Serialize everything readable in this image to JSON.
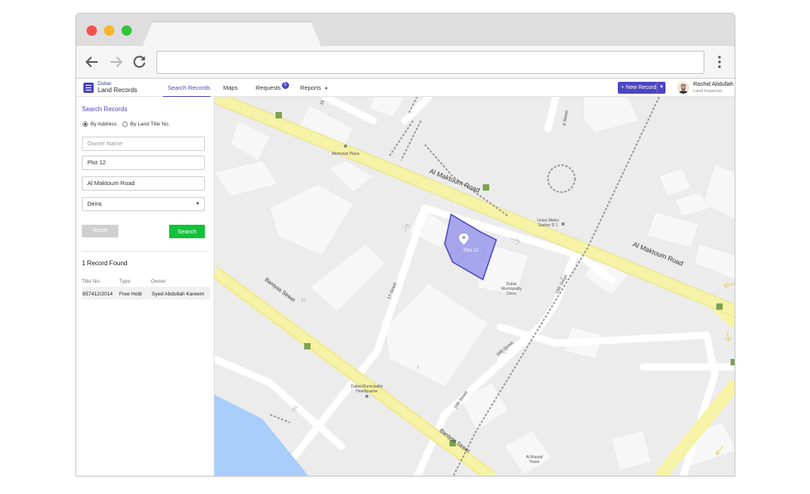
{
  "colors": {
    "accent": "#4c46bf",
    "search_button": "#12c23a",
    "major_road": "#f6f2a6",
    "water": "#a8cdfb",
    "plot_fill": "#9e9cea"
  },
  "app": {
    "brand_line1": "Dubai",
    "brand_line2": "Land Records"
  },
  "nav": {
    "search_records": "Search Records",
    "maps": "Maps",
    "requests": "Requests",
    "requests_count": "5",
    "reports": "Reports"
  },
  "header": {
    "new_record": "New Record",
    "user_name": "Rashid Abdullah",
    "user_role": "Land Inspector"
  },
  "search": {
    "title": "Search Records",
    "option_address": "By Address",
    "option_title_no": "By Land Title No.",
    "owner_placeholder": "Owner Name",
    "plot_value": "Plot 12",
    "street_value": "Al Maktoum Road",
    "area_selected": "Deira",
    "reset_label": "Reset",
    "search_label": "Search"
  },
  "results": {
    "count_label": "1 Record Found",
    "columns": [
      "Title No.",
      "Type",
      "Owner"
    ],
    "rows": [
      [
        "857412/2014",
        "Free Hold",
        "Syed Abdullah Kareem"
      ]
    ]
  },
  "map": {
    "labels": {
      "road_main_1": "Al Maktoum Road",
      "road_main_2": "Al Maktoum Road",
      "road_baniyas_1": "Baniyas Street",
      "road_baniyas_2": "Baniyas Street",
      "street_17": "17 Street",
      "street_19b_1": "19B Street",
      "street_19b_2": "19B Street",
      "street_19b_3": "19B Street",
      "street_8": "8 Street",
      "street_15": "15",
      "memorial_plaza": "Memorial Plaza",
      "metro_line1": "Union Metro",
      "metro_line2": "Station D 1",
      "municipality_1": "Dubai",
      "municipality_2": "Municipality",
      "municipality_3": "Deira",
      "hq_line1": "Dubai Municipality",
      "hq_line2": "Headquarter",
      "masraf_1": "Al Masraf",
      "masraf_2": "Tower",
      "plot": "Plot 12",
      "bldg_37": "37",
      "bldg_2": "2"
    }
  }
}
